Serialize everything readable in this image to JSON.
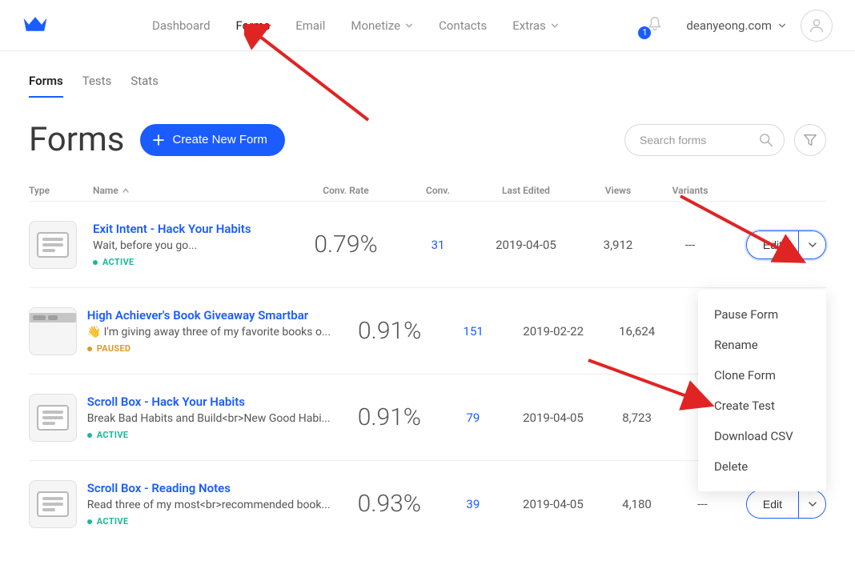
{
  "nav": {
    "items": [
      "Dashboard",
      "Forms",
      "Email",
      "Monetize",
      "Contacts",
      "Extras"
    ],
    "active_index": 1,
    "notifications": "1",
    "account_label": "deanyeong.com"
  },
  "subnav": {
    "tabs": [
      "Forms",
      "Tests",
      "Stats"
    ],
    "active_index": 0
  },
  "header": {
    "title": "Forms",
    "create_button": "Create New Form",
    "search_placeholder": "Search forms"
  },
  "table": {
    "headers": {
      "type": "Type",
      "name": "Name",
      "conv_rate": "Conv. Rate",
      "conv": "Conv.",
      "last_edited": "Last Edited",
      "views": "Views",
      "variants": "Variants"
    },
    "rows": [
      {
        "title": "Exit Intent - Hack Your Habits",
        "subtitle": "Wait, before you go...",
        "status": "ACTIVE",
        "status_class": "active",
        "conv_rate": "0.79%",
        "conv": "31",
        "last_edited": "2019-04-05",
        "views": "3,912",
        "variants": "---",
        "thumb": "box"
      },
      {
        "title": "High Achiever's Book Giveaway Smartbar",
        "subtitle": "👋 I'm giving away three of my favorite books o...",
        "status": "PAUSED",
        "status_class": "paused",
        "conv_rate": "0.91%",
        "conv": "151",
        "last_edited": "2019-02-22",
        "views": "16,624",
        "variants": "",
        "thumb": "bar"
      },
      {
        "title": "Scroll Box - Hack Your Habits",
        "subtitle": "Break Bad Habits and Build<br>New Good Habi...",
        "status": "ACTIVE",
        "status_class": "active",
        "conv_rate": "0.91%",
        "conv": "79",
        "last_edited": "2019-04-05",
        "views": "8,723",
        "variants": "",
        "thumb": "box"
      },
      {
        "title": "Scroll Box - Reading Notes",
        "subtitle": "Read three of my most<br>recommended book...",
        "status": "ACTIVE",
        "status_class": "active",
        "conv_rate": "0.93%",
        "conv": "39",
        "last_edited": "2019-04-05",
        "views": "4,180",
        "variants": "---",
        "thumb": "box"
      }
    ],
    "edit_label": "Edit"
  },
  "dropdown": {
    "items": [
      "Pause Form",
      "Rename",
      "Clone Form",
      "Create Test",
      "Download CSV",
      "Delete"
    ]
  }
}
